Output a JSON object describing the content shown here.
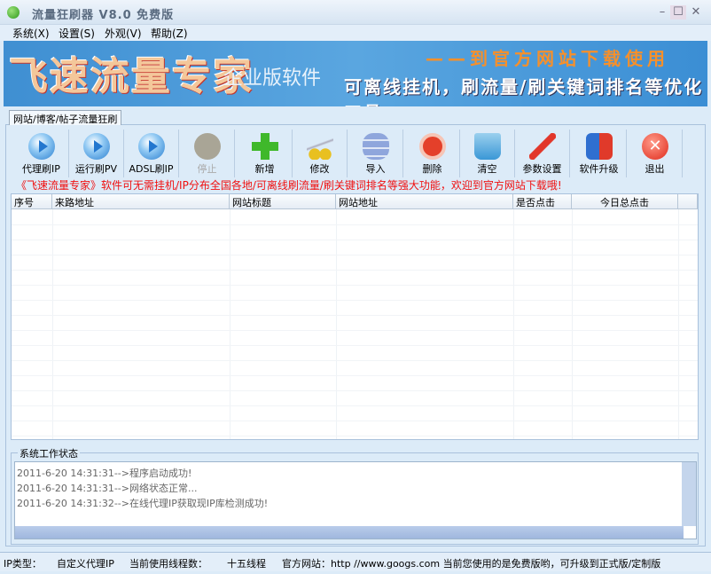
{
  "window": {
    "title": "流量狂刷器  V8.0 免费版",
    "min": "–",
    "max": "☐",
    "close": "✕"
  },
  "menu": [
    "系统(X)",
    "设置(S)",
    "外观(V)",
    "帮助(Z)"
  ],
  "banner": {
    "title": "飞速流量专家",
    "subtitle": "企业版软件",
    "slogan": "——到官方网站下载使用",
    "desc": "可离线挂机，刷流量/刷关键词排名等优化工具"
  },
  "tab": "网站/博客/帖子流量狂刷",
  "toolbar": [
    {
      "label": "代理刷IP",
      "icon": "play-icon"
    },
    {
      "label": "运行刷PV",
      "icon": "play-icon"
    },
    {
      "label": "ADSL刷IP",
      "icon": "play-icon"
    },
    {
      "label": "停止",
      "icon": "stop-icon"
    },
    {
      "label": "新增",
      "icon": "plus-icon"
    },
    {
      "label": "修改",
      "icon": "scissors-icon"
    },
    {
      "label": "导入",
      "icon": "database-icon"
    },
    {
      "label": "删除",
      "icon": "prohibit-icon"
    },
    {
      "label": "清空",
      "icon": "bin-icon"
    },
    {
      "label": "参数设置",
      "icon": "tools-icon"
    },
    {
      "label": "软件升级",
      "icon": "upgrade-icon"
    },
    {
      "label": "退出",
      "icon": "exit-icon"
    }
  ],
  "notice": "《飞速流量专家》软件可无需挂机/IP分布全国各地/可离线刷流量/刷关键词排名等强大功能，欢迎到官方网站下载哦!",
  "table": {
    "columns": [
      "序号",
      "来路地址",
      "网站标题",
      "网站地址",
      "是否点击",
      "今日总点击"
    ]
  },
  "status_group": {
    "label": "系统工作状态",
    "log": [
      "2011-6-20 14:31:31-->程序启动成功!",
      "2011-6-20 14:31:31-->网络状态正常...",
      "2011-6-20 14:31:32-->在线代理IP获取现IP库检测成功!"
    ]
  },
  "statusbar": {
    "ip_type_label": "IP类型：",
    "ip_type": "自定义代理IP",
    "threads_label": "当前使用线程数：",
    "threads": "十五线程",
    "site": "官方网站：http //www.googs.com 当前您使用的是免费版哟，可升级到正式版/定制版"
  }
}
